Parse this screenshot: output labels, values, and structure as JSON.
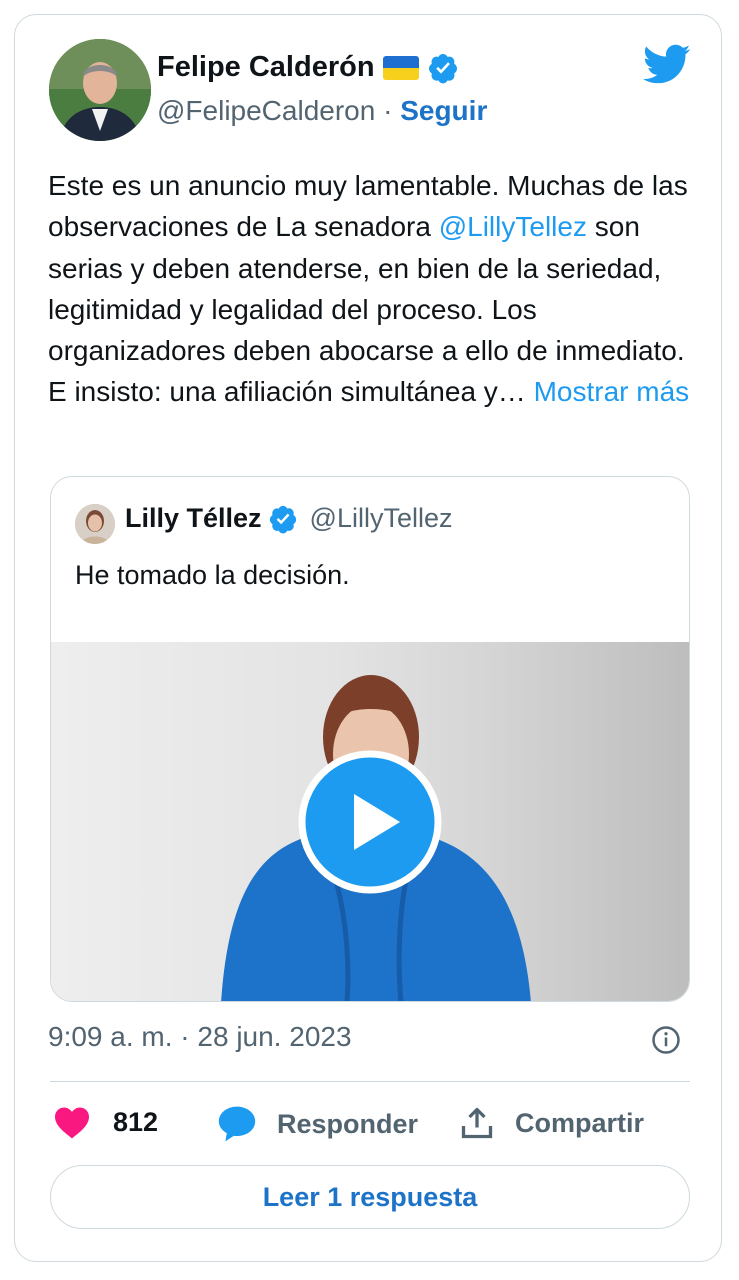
{
  "author": {
    "name": "Felipe Calderón",
    "handle": "@FelipeCalderon",
    "separator": "·",
    "follow_label": "Seguir",
    "flag_icon": "ukraine-flag-icon",
    "verified_icon": "verified-badge-icon"
  },
  "tweet": {
    "text_before_mention": "Este es un anuncio muy lamentable. Muchas de las observaciones de La senadora ",
    "mention": "@LillyTellez",
    "text_after_mention": " son serias y deben atenderse, en bien de la seriedad, legitimidad y legalidad del proceso. Los organizadores deben abocarse a ello de inmediato. E insisto: una afiliación simultánea y…",
    "show_more_label": "Mostrar más"
  },
  "quoted": {
    "name": "Lilly Téllez",
    "handle": "@LillyTellez",
    "text": "He tomado la decisión.",
    "media": "video"
  },
  "timestamp": "9:09 a. m. · 28 jun. 2023",
  "actions": {
    "likes": "812",
    "reply_label": "Responder",
    "share_label": "Compartir"
  },
  "read_replies_label": "Leer 1 respuesta",
  "colors": {
    "accent": "#1d9bf0",
    "link_blue": "#1d73c7",
    "like_pink": "#f91880",
    "muted": "#536471",
    "border": "#cfd9de"
  }
}
